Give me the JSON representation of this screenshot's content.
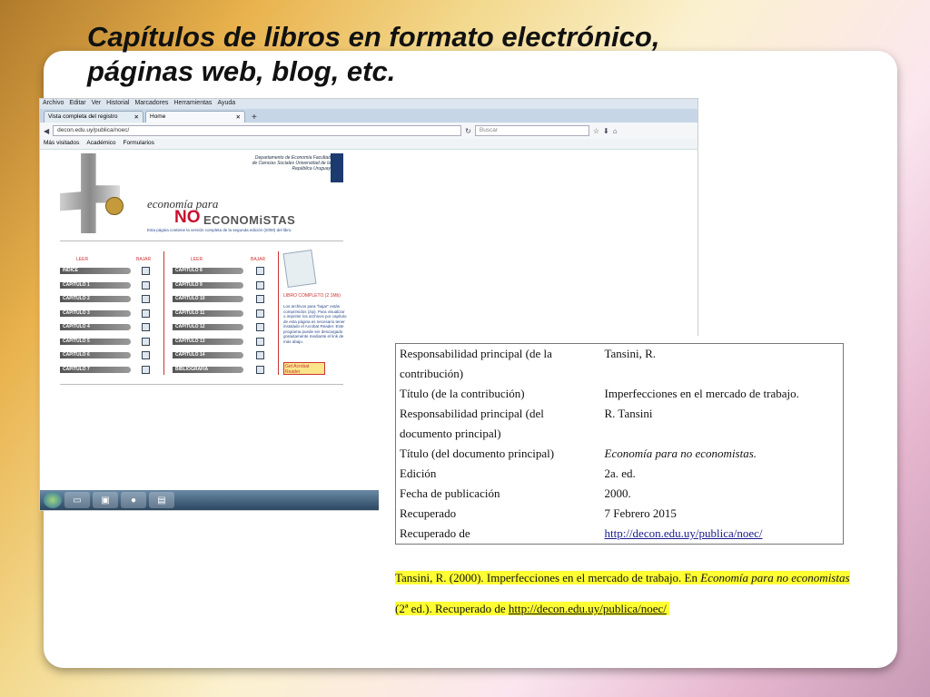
{
  "slide": {
    "title_line1": "Capítulos de libros en formato electrónico,",
    "title_line2": "páginas web, blog, etc."
  },
  "browser": {
    "menu": [
      "Archivo",
      "Editar",
      "Ver",
      "Historial",
      "Marcadores",
      "Herramientas",
      "Ayuda"
    ],
    "tabs": [
      {
        "label": "Vista completa del registro"
      },
      {
        "label": "Home"
      }
    ],
    "url": "decon.edu.uy/publica/noec/",
    "search_placeholder": "Buscar",
    "bookmarks": [
      "Más visitados",
      "Académico",
      "Formularios"
    ]
  },
  "site": {
    "dept": "Departamento de Economía Facultad de Ciencias Sociales Universidad de la República Uruguay",
    "brand_line1": "economía para",
    "brand_no": "NO",
    "brand_rest": "ECONOMiSTAS",
    "brand_sub": "Esta página contiene la versión completa de la segunda edición (2000) del libro.",
    "col_leer": "LEER",
    "col_bajar": "BAJAR",
    "chapters_left": [
      "INDICE",
      "CAPITULO 1",
      "CAPITULO 2",
      "CAPITULO 3",
      "CAPITULO 4",
      "CAPITULO 5",
      "CAPITULO 6",
      "CAPITULO 7"
    ],
    "chapters_right": [
      "CAPITULO 8",
      "CAPITULO 9",
      "CAPITULO 10",
      "CAPITULO 11",
      "CAPITULO 12",
      "CAPITULO 13",
      "CAPITULO 14",
      "BIBLIOGRAFIA"
    ],
    "libro_completo": "LIBRO COMPLETO (2.1Mb)",
    "note": "Los archivos para \"bajar\" están comprimidos (zip). Para visualizar o imprimir los archivos por capítulo de esta página es necesario tener instalado el Acrobat Reader. Este programa puede ser descargado gratuitamente mediante el link de más abajo.",
    "acrobat": "Get Acrobat Reader"
  },
  "reference": {
    "rows": [
      {
        "label": "Responsabilidad principal (de la contribución)",
        "value": "Tansini, R."
      },
      {
        "label": "Título (de la contribución)",
        "value": "Imperfecciones en el mercado de trabajo."
      },
      {
        "label": "Responsabilidad principal (del documento principal)",
        "value": "R. Tansini"
      },
      {
        "label": "Título (del documento principal)",
        "value": "Economía para no economistas."
      },
      {
        "label": "Edición",
        "value": "2a. ed."
      },
      {
        "label": "Fecha de publicación",
        "value": "2000."
      },
      {
        "label": "Recuperado",
        "value": "7 Febrero 2015"
      },
      {
        "label": "Recuperado de",
        "value": "http://decon.edu.uy/publica/noec/"
      }
    ],
    "cite_part1": "Tansini, R. (2000). Imperfecciones en el mercado de trabajo. En ",
    "cite_italic": "Economía para no economistas",
    "cite_part2": "(2ª ed.). Recuperado de ",
    "cite_link": "http://decon.edu.uy/publica/noec/"
  },
  "colors": {
    "highlight": "#ffff33",
    "brand_red": "#c8102e"
  }
}
